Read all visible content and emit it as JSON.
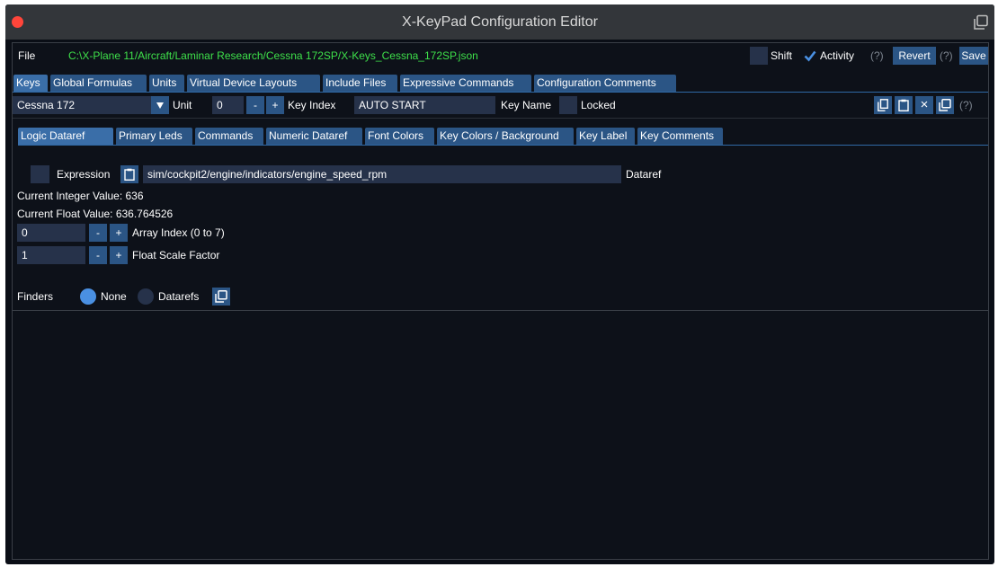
{
  "window": {
    "title": "X-KeyPad Configuration Editor"
  },
  "file_bar": {
    "label": "File",
    "path": "C:\\X-Plane 11/Aircraft/Laminar Research/Cessna 172SP/X-Keys_Cessna_172SP.json",
    "shift_label": "Shift",
    "activity_label": "Activity",
    "help_label": "(?)",
    "revert_label": "Revert",
    "save_label": "Save"
  },
  "main_tabs": [
    "Keys",
    "Global Formulas",
    "Units",
    "Virtual Device Layouts",
    "Include Files",
    "Expressive Commands",
    "Configuration Comments"
  ],
  "key_bar": {
    "device_value": "Cessna 172",
    "unit_label": "Unit",
    "unit_value": "0",
    "minus_label": "-",
    "plus_label": "+",
    "key_index_label": "Key Index",
    "key_index_value": "AUTO START",
    "key_name_label": "Key Name",
    "locked_label": "Locked",
    "close_glyph": "×",
    "help_label": "(?)"
  },
  "sub_tabs": [
    "Logic Dataref",
    "Primary Leds",
    "Commands",
    "Numeric Dataref",
    "Font Colors",
    "Key Colors / Background",
    "Key Label",
    "Key Comments"
  ],
  "logic": {
    "expression_label": "Expression",
    "dataref_value": "sim/cockpit2/engine/indicators/engine_speed_rpm",
    "dataref_label": "Dataref",
    "current_integer": "Current Integer Value: 636",
    "current_float": "Current Float Value: 636.764526",
    "array_index_value": "0",
    "array_index_label": "Array Index (0 to 7)",
    "float_scale_value": "1",
    "float_scale_label": "Float Scale Factor",
    "minus_label": "-",
    "plus_label": "+",
    "finders_label": "Finders",
    "none_label": "None",
    "datarefs_label": "Datarefs"
  },
  "colors": {
    "accent": "#2b5585",
    "path_green": "#3ee04a",
    "radio_on": "#4a90e2",
    "close_red": "#ff453a"
  }
}
